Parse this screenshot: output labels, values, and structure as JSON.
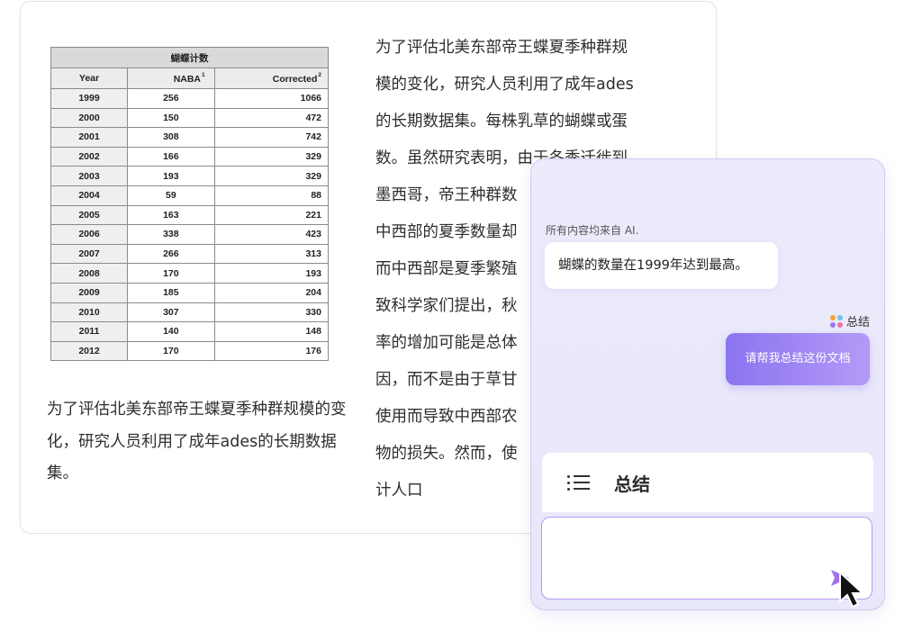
{
  "table": {
    "title": "蝴蝶计数",
    "headers": {
      "year": "Year",
      "naba": "NABA",
      "naba_sup": "1",
      "corrected": "Corrected",
      "corrected_sup": "2"
    },
    "rows": [
      {
        "year": "1999",
        "naba": "256",
        "corrected": "1066"
      },
      {
        "year": "2000",
        "naba": "150",
        "corrected": "472"
      },
      {
        "year": "2001",
        "naba": "308",
        "corrected": "742"
      },
      {
        "year": "2002",
        "naba": "166",
        "corrected": "329"
      },
      {
        "year": "2003",
        "naba": "193",
        "corrected": "329"
      },
      {
        "year": "2004",
        "naba": "59",
        "corrected": "88"
      },
      {
        "year": "2005",
        "naba": "163",
        "corrected": "221"
      },
      {
        "year": "2006",
        "naba": "338",
        "corrected": "423"
      },
      {
        "year": "2007",
        "naba": "266",
        "corrected": "313"
      },
      {
        "year": "2008",
        "naba": "170",
        "corrected": "193"
      },
      {
        "year": "2009",
        "naba": "185",
        "corrected": "204"
      },
      {
        "year": "2010",
        "naba": "307",
        "corrected": "330"
      },
      {
        "year": "2011",
        "naba": "140",
        "corrected": "148"
      },
      {
        "year": "2012",
        "naba": "170",
        "corrected": "176"
      }
    ]
  },
  "left_paragraph": "为了评估北美东部帝王蝶夏季种群规模的变化，研究人员利用了成年ades的长期数据集。",
  "right_paragraph_lines": [
    "为了评估北美东部帝王蝶夏季种群规",
    "模的变化，研究人员利用了成年ades",
    "的长期数据集。每株乳草的蝴蝶或蛋",
    "数。虽然研究表明，由于冬季迁徙到",
    "墨西哥，帝王种群数",
    "中西部的夏季数量却",
    "而中西部是夏季繁殖",
    "致科学家们提出，秋",
    "率的增加可能是总体",
    "因，而不是由于草甘",
    "使用而导致中西部农",
    "物的损失。然而，使",
    "计人口"
  ],
  "ai_panel": {
    "note": "所有内容均来自 AI.",
    "ai_reply": "蝴蝶的数量在1999年达到最高。",
    "summary_tag": "总结",
    "user_message": "请帮我总结这份文档",
    "summary_bar_label": "总结",
    "input_value": "",
    "colors": {
      "accent": "#8c73f0",
      "dot1": "#f3a43b",
      "dot2": "#6cc3f0",
      "dot3": "#9b7cf2",
      "dot4": "#ef6fa8"
    }
  },
  "icons": {
    "summary_tag_icon": "four-dots-icon",
    "list": "list-icon",
    "send": "send-icon",
    "cursor": "mouse-cursor-icon"
  }
}
